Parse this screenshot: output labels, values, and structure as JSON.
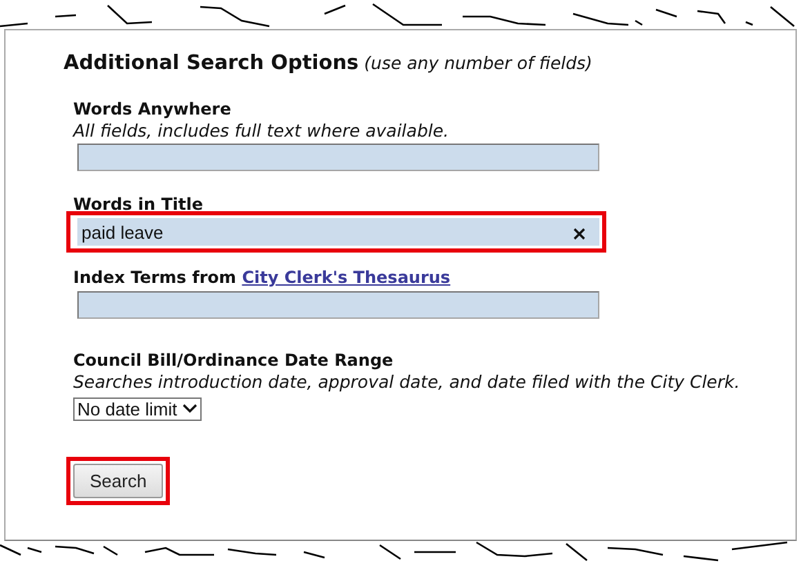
{
  "heading": {
    "title": "Additional Search Options",
    "note": "(use any number of fields)"
  },
  "fields": [
    {
      "kind": "text",
      "label": "Words Anywhere",
      "hint": "All fields, includes full text where available.",
      "highlighted": false
    },
    {
      "kind": "text",
      "label": "Words in Title",
      "value": "paid leave",
      "highlighted": true
    },
    {
      "kind": "text",
      "label": "Index Terms from",
      "link": "City Clerk's Thesaurus",
      "highlighted": false
    },
    {
      "kind": "select",
      "label": "Council Bill/Ordinance Date Range",
      "hint": "Searches introduction date, approval date, and date filed with the City Clerk.",
      "value": "No date limit",
      "highlighted": false
    }
  ],
  "button": {
    "label": "Search",
    "highlighted": true
  }
}
